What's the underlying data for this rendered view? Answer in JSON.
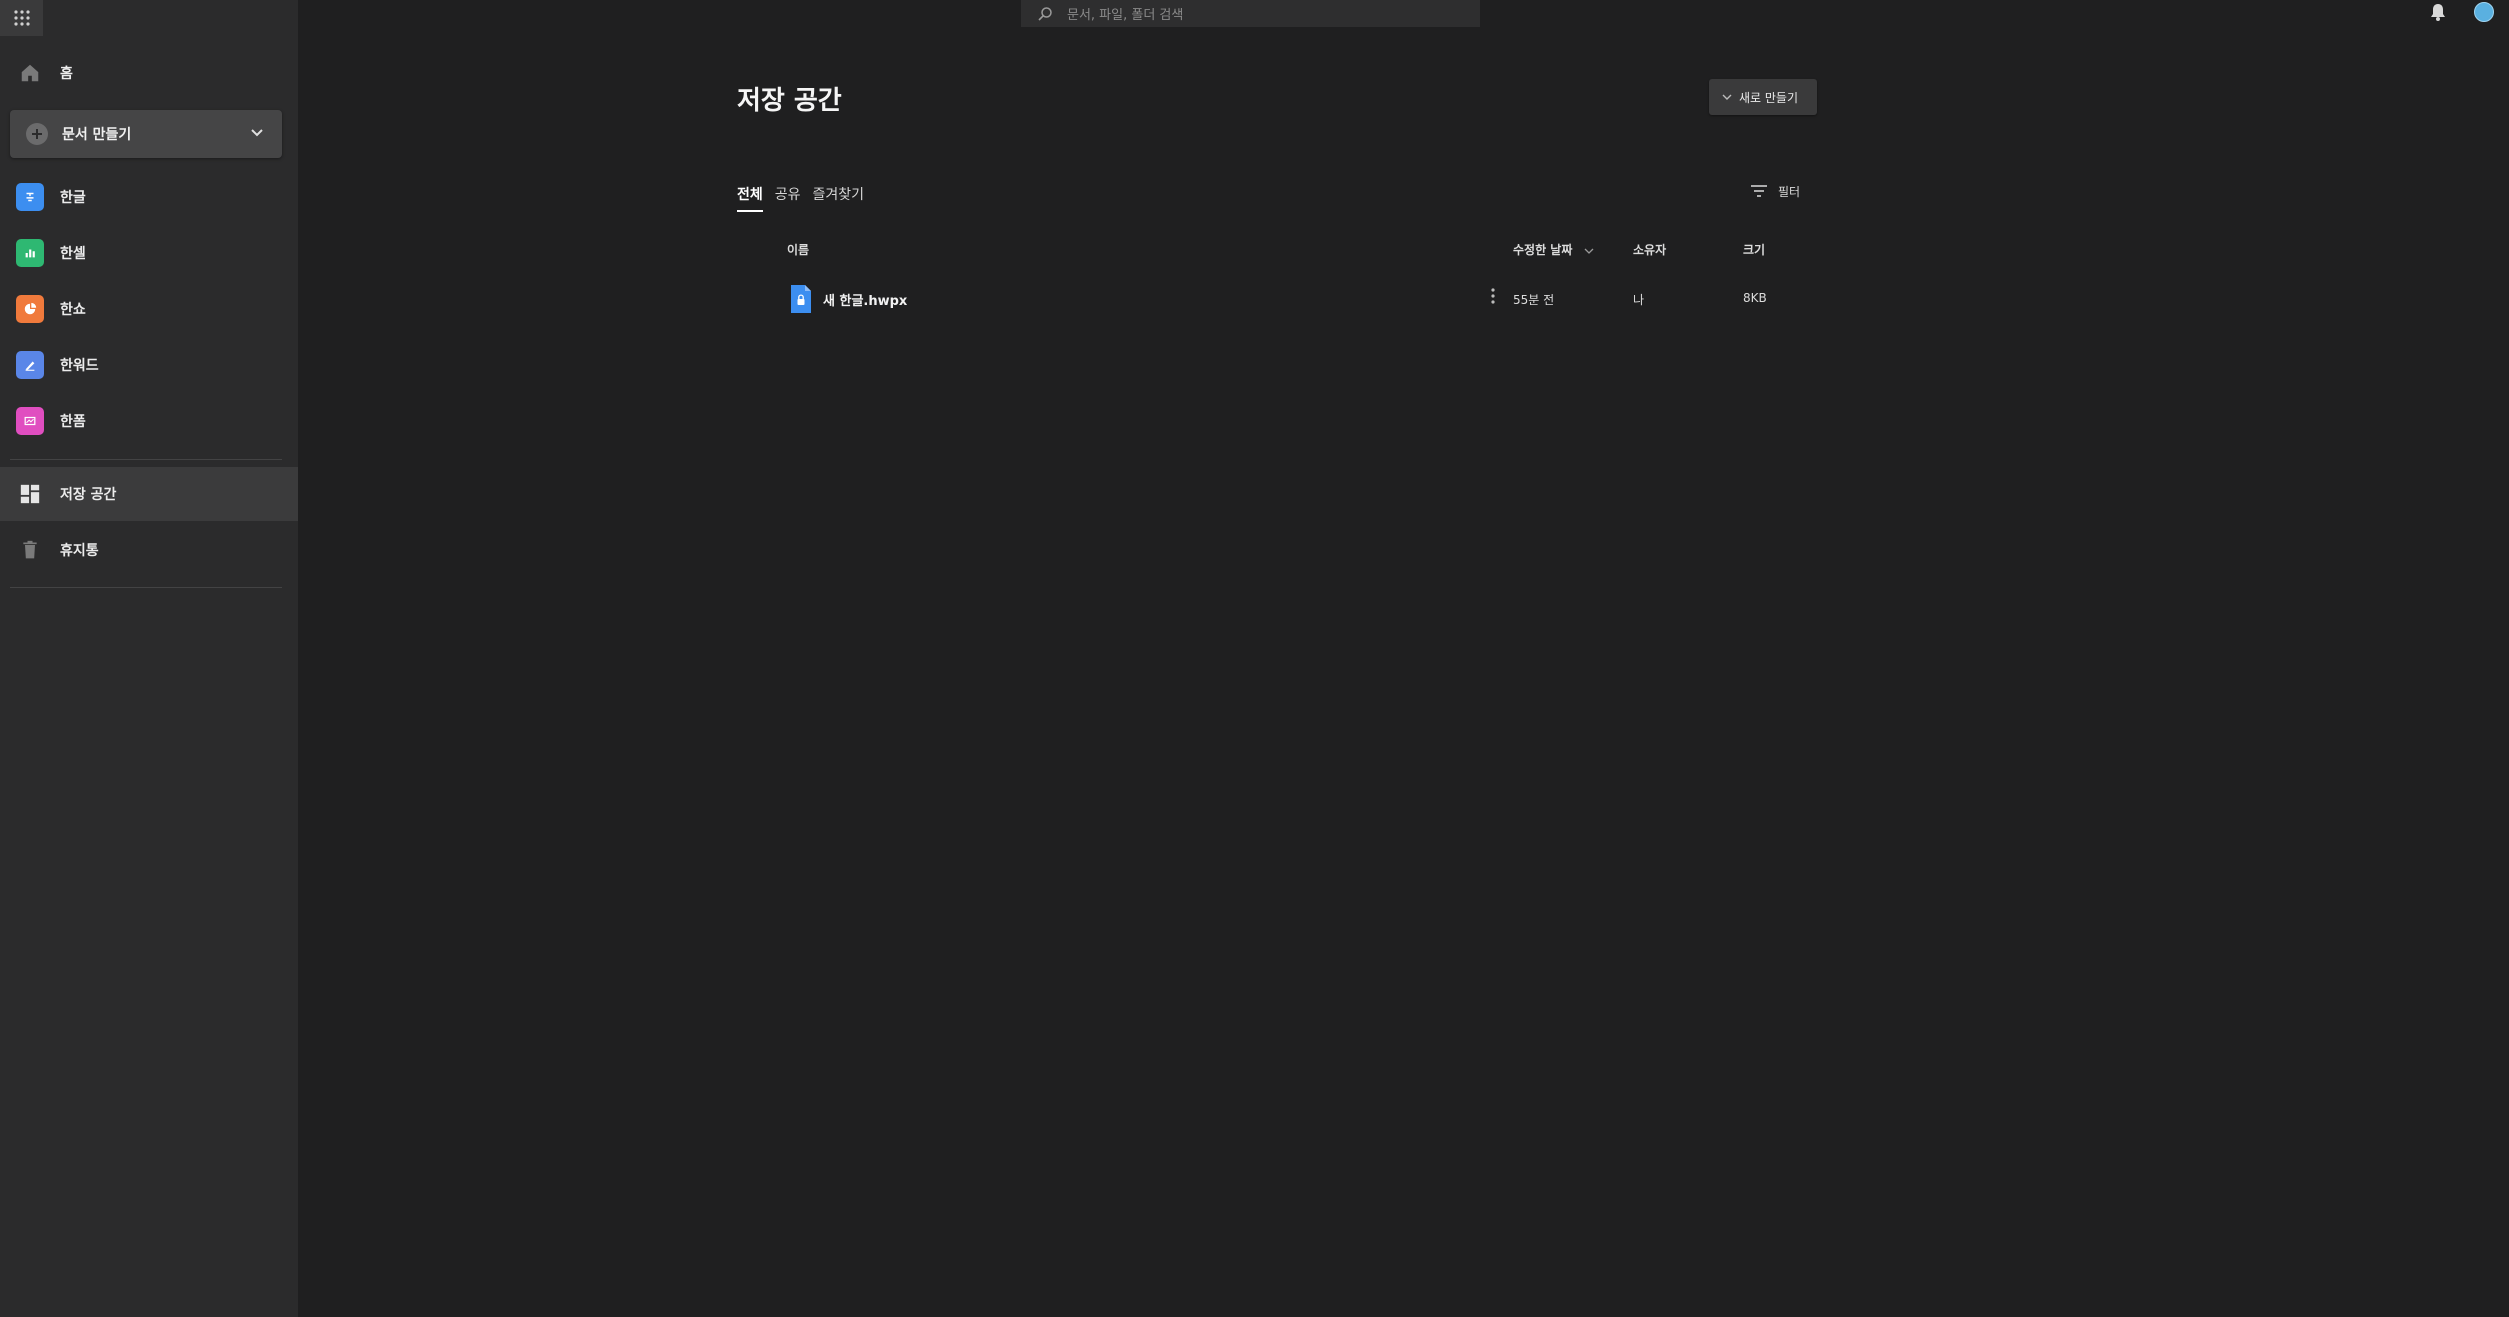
{
  "sidebar": {
    "home_label": "홈",
    "create_label": "문서 만들기",
    "apps": [
      {
        "label": "한글",
        "color": "#3c8ef0"
      },
      {
        "label": "한셀",
        "color": "#2eb872"
      },
      {
        "label": "한쇼",
        "color": "#f07a3c"
      },
      {
        "label": "한워드",
        "color": "#5a86e8"
      },
      {
        "label": "한폼",
        "color": "#e04ec0"
      }
    ],
    "storage_label": "저장 공간",
    "trash_label": "휴지통"
  },
  "header": {
    "search_placeholder": "문서, 파일, 폴더 검색"
  },
  "main": {
    "title": "저장 공간",
    "new_button_label": "새로 만들기",
    "tabs": [
      {
        "label": "전체",
        "active": true
      },
      {
        "label": "공유",
        "active": false
      },
      {
        "label": "즐겨찾기",
        "active": false
      }
    ],
    "filter_label": "필터",
    "columns": {
      "name": "이름",
      "modified": "수정한 날짜",
      "owner": "소유자",
      "size": "크기"
    },
    "files": [
      {
        "name": "새 한글.hwpx",
        "modified": "55분 전",
        "owner": "나",
        "size": "8KB"
      }
    ]
  }
}
